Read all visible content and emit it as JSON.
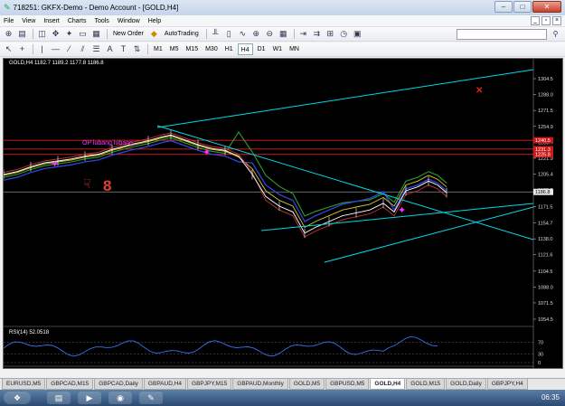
{
  "window": {
    "title": "718251: GKFX-Demo - Demo Account - [GOLD,H4]",
    "min": "–",
    "max": "□",
    "close": "✕"
  },
  "menu": [
    "File",
    "View",
    "Insert",
    "Charts",
    "Tools",
    "Window",
    "Help"
  ],
  "toolbar": {
    "new_order": "New Order",
    "autotrading": "AutoTrading"
  },
  "timeframes": [
    "M1",
    "M5",
    "M15",
    "M30",
    "H1",
    "H4",
    "D1",
    "W1",
    "MN"
  ],
  "active_timeframe": "H4",
  "chart": {
    "header": "GOLD,H4  1182.7 1189.2 1177.8 1186.8",
    "annotation": "OP lubang lubang",
    "rsi_label": "RSI(14) 52.0518"
  },
  "chart_data": {
    "type": "line",
    "symbol": "GOLD",
    "timeframe": "H4",
    "price_ticks": [
      "1304.5",
      "1288.0",
      "1271.5",
      "1254.9",
      "1238.4",
      "1221.9",
      "1205.4",
      "1188.8",
      "1171.5",
      "1154.7",
      "1138.0",
      "1121.6",
      "1104.5",
      "1088.0",
      "1071.5",
      "1054.5"
    ],
    "price_badges": [
      "1240.5",
      "1231.3",
      "1225.8",
      "1186.8"
    ],
    "rsi_ticks": [
      "70",
      "30",
      "0"
    ],
    "time_labels": [
      "3 Oct 2014",
      "8 Oct 12:00",
      "13 Oct 04:00",
      "15 Oct 20:00",
      "20 Oct 12:00",
      "23 Oct 04:00",
      "27 Oct 20:00",
      "30 Oct 12:00",
      "4 Nov 04:00",
      "6 Nov 20:00",
      "11 Nov 12:00",
      "14 Nov 04:00",
      "18 Nov 20:00"
    ],
    "ylim": [
      1054.5,
      1304.5
    ],
    "colors": {
      "price": "#ffffff",
      "trendline": "#00d8e8",
      "level": "#ff2a2a",
      "ma_green": "#2e9e2e",
      "ma_blue": "#3344dd",
      "ma_yellow": "#d8c830",
      "rsi": "#3a6ff0"
    }
  },
  "tabs": [
    "EURUSD,M5",
    "GBPCAD,M15",
    "GBPCAD,Daily",
    "GBPAUD,H4",
    "GBPJPY,M15",
    "GBPAUD,Monthly",
    "GOLD,M5",
    "GBPUSD,M5",
    "GOLD,H4",
    "GOLD,M15",
    "GOLD,Daily",
    "GBPJPY,H4"
  ],
  "active_tab": "GOLD,H4",
  "taskbar": {
    "clock": "06:35"
  }
}
